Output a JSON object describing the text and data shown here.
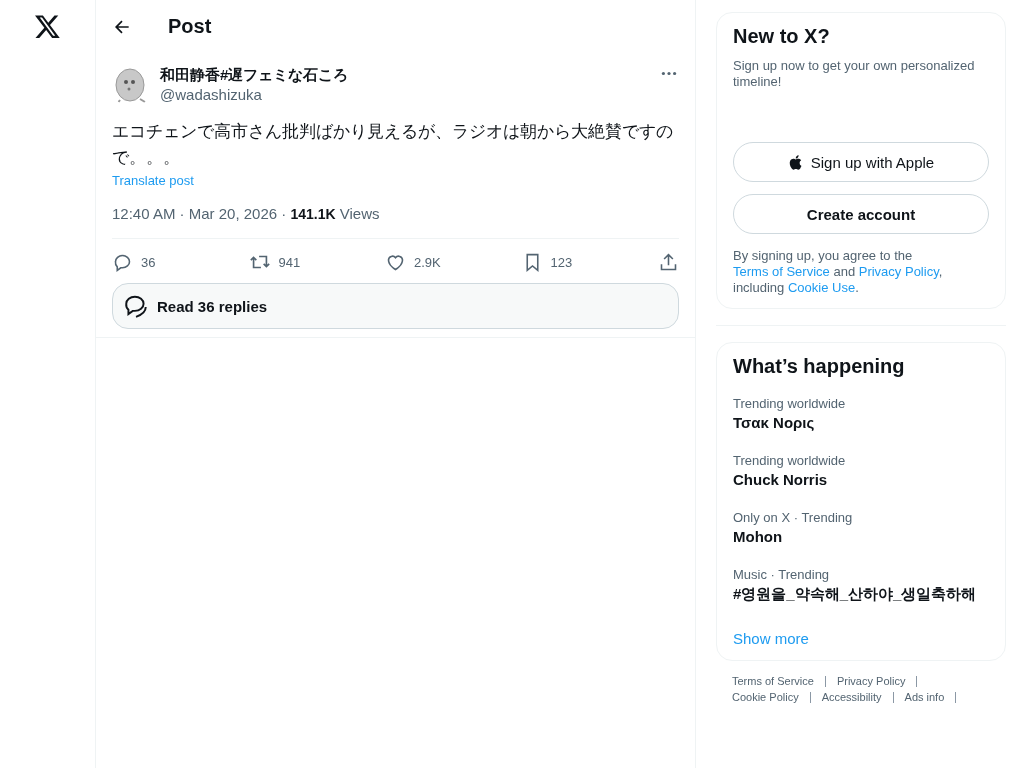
{
  "header": {
    "title": "Post"
  },
  "post": {
    "display_name": "和田静香#遅フェミな石ころ",
    "handle": "@wadashizuka",
    "text": "エコチェンで高市さん批判ばかり見えるが、ラジオは朝から大絶賛ですので。。。",
    "translate": "Translate post",
    "time": "12:40 AM · Mar 20, 2026 · ",
    "views_count": "141.1K",
    "views_label": " Views",
    "actions": [
      {
        "kind": "reply",
        "count": "36"
      },
      {
        "kind": "repost",
        "count": "941"
      },
      {
        "kind": "like",
        "count": "2.9K"
      },
      {
        "kind": "bookmark",
        "count": "123"
      },
      {
        "kind": "share"
      }
    ],
    "read_replies": "Read 36 replies"
  },
  "signup": {
    "title": "New to X?",
    "subtitle": "Sign up now to get your own personalized timeline!",
    "apple_button": "Sign up with Apple",
    "create_button": "Create account",
    "legal": "By signing up, you agree to the ",
    "terms": "Terms of Service",
    "and": " and ",
    "privacy": "Privacy Policy",
    "including": ", including ",
    "cookie": "Cookie Use",
    "end": "."
  },
  "trends": {
    "title": "What’s happening",
    "items": [
      {
        "context": "Trending worldwide",
        "name": "Τσακ Νορις"
      },
      {
        "context": "Trending worldwide",
        "name": "Chuck Norris"
      },
      {
        "context": "Only on X · Trending",
        "name": "Mohon"
      },
      {
        "context": "Music · Trending",
        "name": "#영원을_약속해_산하야_생일축하해"
      }
    ],
    "show_more": "Show more"
  },
  "footer_links": [
    "Terms of Service",
    "Privacy Policy",
    "Cookie Policy",
    "Accessibility",
    "Ads info"
  ]
}
